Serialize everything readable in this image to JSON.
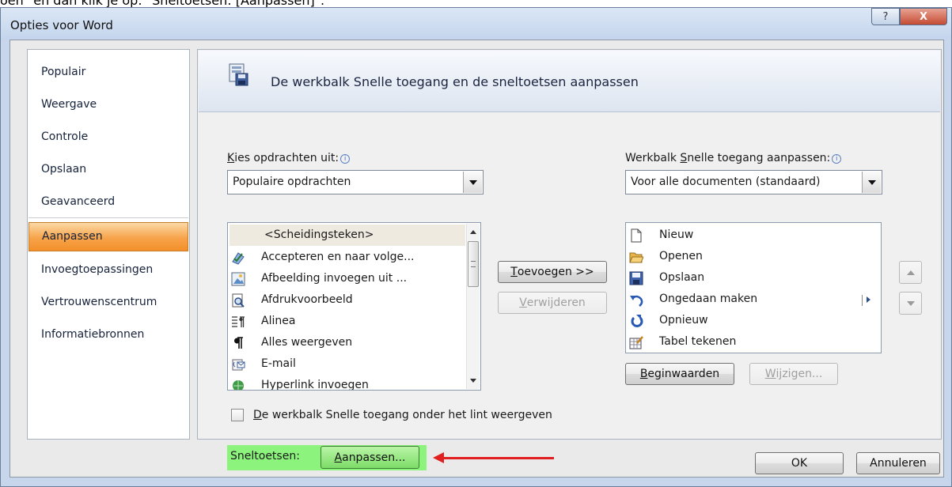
{
  "caption": {
    "text": "oen\" en dan klik je op: \"Sneltoetsen: [Aanpassen]\"."
  },
  "window": {
    "title": "Opties voor Word",
    "help_label": "?",
    "close_label": "X"
  },
  "nav": {
    "items": [
      {
        "label": "Populair"
      },
      {
        "label": "Weergave"
      },
      {
        "label": "Controle"
      },
      {
        "label": "Opslaan"
      },
      {
        "label": "Geavanceerd"
      },
      {
        "label": "Aanpassen"
      },
      {
        "label": "Invoegtoepassingen"
      },
      {
        "label": "Vertrouwenscentrum"
      },
      {
        "label": "Informatiebronnen"
      }
    ],
    "active": "Aanpassen"
  },
  "content": {
    "header": {
      "title": "De werkbalk Snelle toegang en de sneltoetsen aanpassen"
    },
    "commands": {
      "label_first": "K",
      "label_rest": "ies opdrachten uit:",
      "dropdown_value": "Populaire opdrachten",
      "items": [
        {
          "label": "<Scheidingsteken>",
          "icon": "separator-icon"
        },
        {
          "label": "Accepteren en naar volge...",
          "icon": "accept-change-icon"
        },
        {
          "label": "Afbeelding invoegen uit ...",
          "icon": "insert-picture-icon"
        },
        {
          "label": "Afdrukvoorbeeld",
          "icon": "print-preview-icon"
        },
        {
          "label": "Alinea",
          "icon": "paragraph-icon"
        },
        {
          "label": "Alles weergeven",
          "icon": "pilcrow-icon"
        },
        {
          "label": "E-mail",
          "icon": "email-icon"
        },
        {
          "label": "Hyperlink invoegen",
          "icon": "hyperlink-icon"
        }
      ]
    },
    "qat": {
      "label_before": "Werkbalk ",
      "label_u": "S",
      "label_rest": "nelle toegang aanpassen:",
      "dropdown_value": "Voor alle documenten (standaard)",
      "items": [
        {
          "label": "Nieuw",
          "icon": "new-document-icon"
        },
        {
          "label": "Openen",
          "icon": "open-folder-icon"
        },
        {
          "label": "Opslaan",
          "icon": "save-icon"
        },
        {
          "label": "Ongedaan maken",
          "icon": "undo-icon"
        },
        {
          "label": "Opnieuw",
          "icon": "redo-icon"
        },
        {
          "label": "Tabel tekenen",
          "icon": "draw-table-icon"
        }
      ]
    },
    "buttons": {
      "add_u": "T",
      "add_rest": "oevoegen >>",
      "remove_u": "V",
      "remove_rest": "erwijderen",
      "reset_u": "B",
      "reset_rest": "eginwaarden",
      "modify_u": "W",
      "modify_rest": "ijzigen..."
    },
    "checkbox": {
      "u": "D",
      "rest": "e werkbalk Snelle toegang onder het lint weergeven",
      "checked": false
    },
    "shortcuts": {
      "label": "Sneltoetsen:",
      "button_u": "A",
      "button_rest": "anpassen..."
    }
  },
  "footer": {
    "ok_label": "OK",
    "cancel_label": "Annuleren"
  },
  "colors": {
    "nav_active": "#f7a34a",
    "highlight": "#8cf37c",
    "annotation_arrow": "#e02020"
  }
}
